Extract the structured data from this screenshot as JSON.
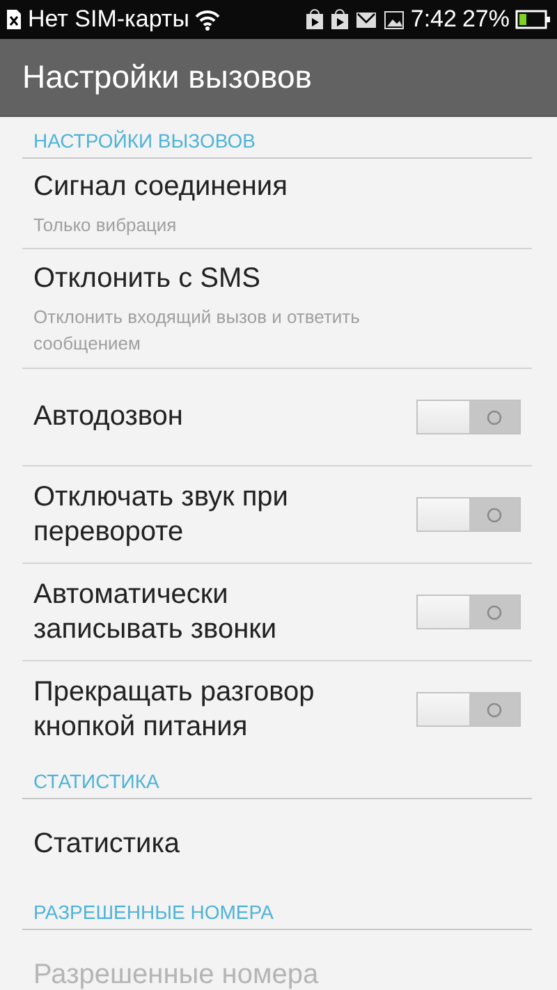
{
  "status_bar": {
    "carrier": "Нет SIM-карты",
    "time": "7:42",
    "battery_percent": "27%"
  },
  "action_bar": {
    "title": "Настройки вызовов"
  },
  "sections": [
    {
      "header": "НАСТРОЙКИ ВЫЗОВОВ",
      "items": [
        {
          "kind": "text",
          "title": "Сигнал соединения",
          "summary": "Только вибрация",
          "disabled": false
        },
        {
          "kind": "text",
          "title": "Отклонить с SMS",
          "summary": "Отклонить входящий вызов и ответить сообщением",
          "disabled": false
        },
        {
          "kind": "switch",
          "title": "Автодозвон",
          "on": false
        },
        {
          "kind": "switch",
          "title": "Отключать звук при перевороте",
          "on": false
        },
        {
          "kind": "switch",
          "title": "Автоматически записывать звонки",
          "on": false
        },
        {
          "kind": "switch",
          "title": "Прекращать разговор кнопкой питания",
          "on": false
        }
      ]
    },
    {
      "header": "СТАТИСТИКА",
      "items": [
        {
          "kind": "text",
          "title": "Статистика",
          "disabled": false
        }
      ]
    },
    {
      "header": "РАЗРЕШЕННЫЕ НОМЕРА",
      "items": [
        {
          "kind": "text",
          "title": "Разрешенные номера",
          "disabled": true
        }
      ]
    }
  ]
}
